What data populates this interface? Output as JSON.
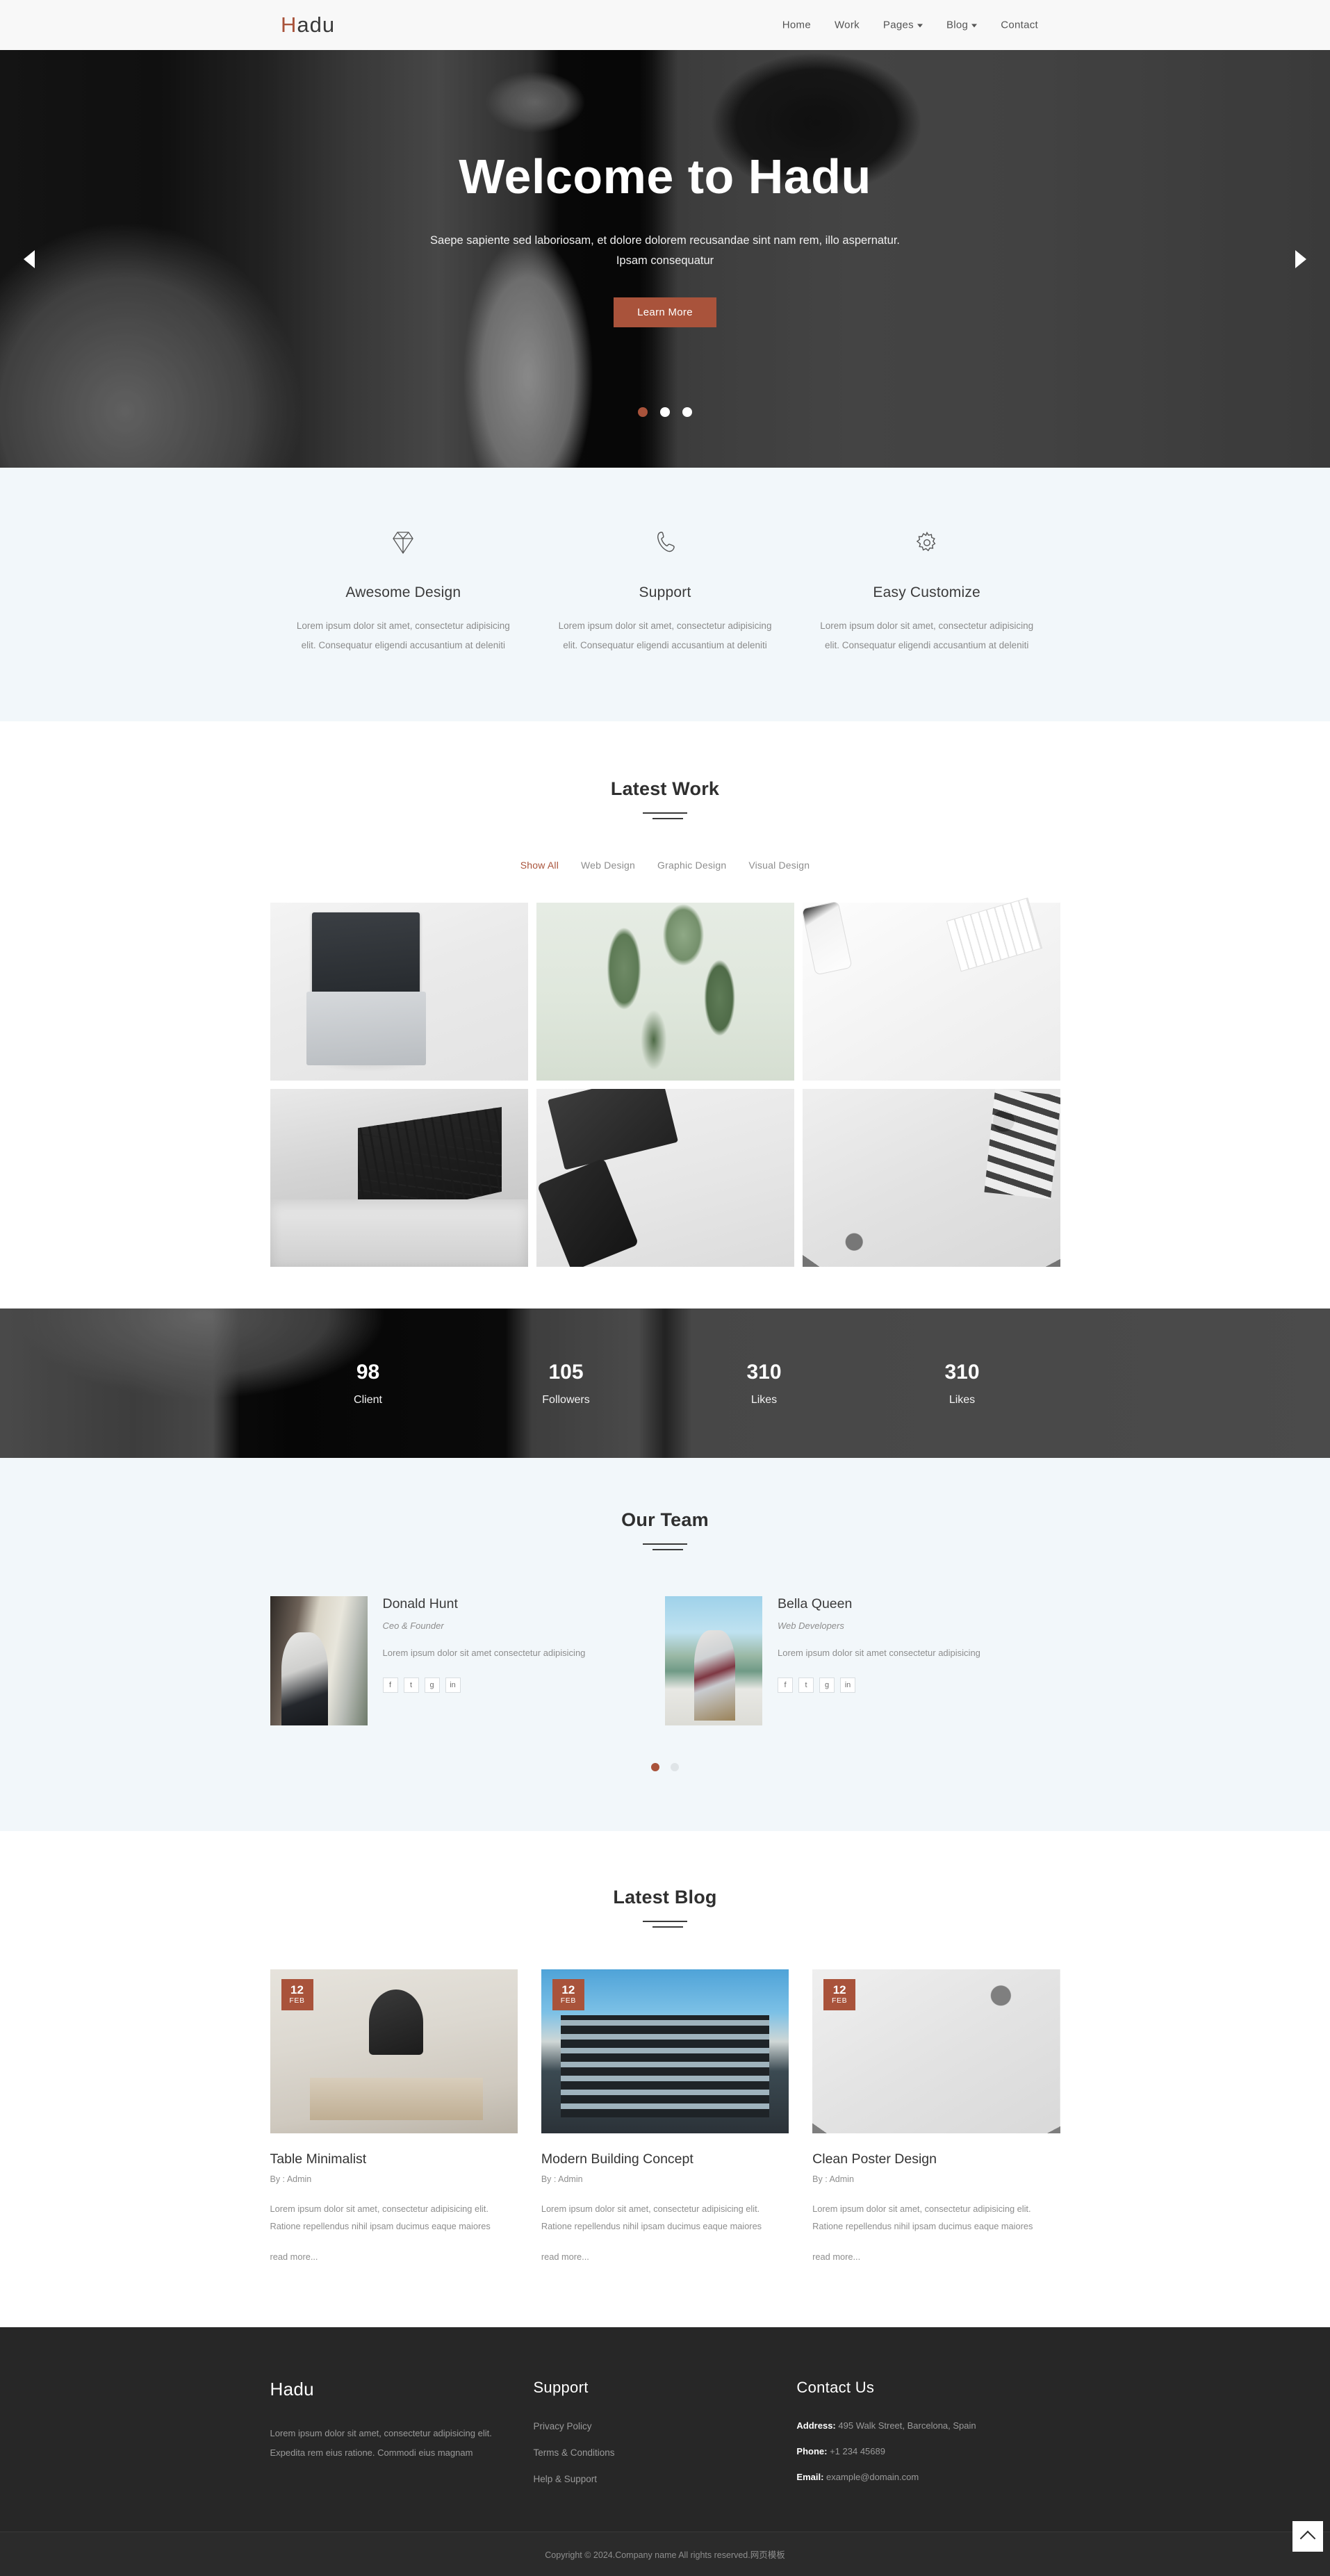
{
  "brand": {
    "first": "H",
    "rest": "adu",
    "full": "Hadu"
  },
  "nav": [
    {
      "label": "Home",
      "dropdown": false
    },
    {
      "label": "Work",
      "dropdown": false
    },
    {
      "label": "Pages",
      "dropdown": true
    },
    {
      "label": "Blog",
      "dropdown": true
    },
    {
      "label": "Contact",
      "dropdown": false
    }
  ],
  "hero": {
    "title": "Welcome to Hadu",
    "subtitle": "Saepe sapiente sed laboriosam, et dolore dolorem recusandae sint nam rem, illo aspernatur. Ipsam consequatur",
    "button": "Learn More",
    "prev_icon": "chevron-left-icon",
    "next_icon": "chevron-right-icon",
    "slide_count": 3,
    "active_slide": 1
  },
  "services": [
    {
      "icon": "diamond-icon",
      "title": "Awesome Design",
      "text": "Lorem ipsum dolor sit amet, consectetur adipisicing elit. Consequatur eligendi accusantium at deleniti"
    },
    {
      "icon": "phone-icon",
      "title": "Support",
      "text": "Lorem ipsum dolor sit amet, consectetur adipisicing elit. Consequatur eligendi accusantium at deleniti"
    },
    {
      "icon": "gear-icon",
      "title": "Easy Customize",
      "text": "Lorem ipsum dolor sit amet, consectetur adipisicing elit. Consequatur eligendi accusantium at deleniti"
    }
  ],
  "work": {
    "title": "Latest Work",
    "filters": [
      {
        "label": "Show All",
        "active": true
      },
      {
        "label": "Web Design",
        "active": false
      },
      {
        "label": "Graphic Design",
        "active": false
      },
      {
        "label": "Visual Design",
        "active": false
      }
    ],
    "items": [
      {
        "alt": "laptop-notebook-ruler-pencil-flatlay"
      },
      {
        "alt": "green-plant-leaves"
      },
      {
        "alt": "phone-keyboard-notebook-earphones-desk"
      },
      {
        "alt": "black-white-architecture-staircase"
      },
      {
        "alt": "notebook-phone-laptop-flatlay"
      },
      {
        "alt": "typography-posters-collage"
      }
    ]
  },
  "counters": [
    {
      "num": "98",
      "label": "Client"
    },
    {
      "num": "105",
      "label": "Followers"
    },
    {
      "num": "310",
      "label": "Likes"
    },
    {
      "num": "310",
      "label": "Likes"
    }
  ],
  "team": {
    "title": "Our Team",
    "members": [
      {
        "name": "Donald Hunt",
        "role": "Ceo & Founder",
        "text": "Lorem ipsum dolor sit amet consectetur adipisicing",
        "photo_alt": "man-in-shirt-and-tie-sitting-by-window",
        "socials": [
          "facebook-icon",
          "twitter-icon",
          "google-plus-icon",
          "linkedin-icon"
        ]
      },
      {
        "name": "Bella Queen",
        "role": "Web Developers",
        "text": "Lorem ipsum dolor sit amet consectetur adipisicing",
        "photo_alt": "man-with-sunglasses-by-mountain-lake",
        "socials": [
          "facebook-icon",
          "twitter-icon",
          "google-plus-icon",
          "linkedin-icon"
        ]
      }
    ],
    "dot_count": 2,
    "active_dot": 1
  },
  "blog": {
    "title": "Latest Blog",
    "posts": [
      {
        "day": "12",
        "month": "FEB",
        "title": "Table Minimalist",
        "by": "By : Admin",
        "text": "Lorem ipsum dolor sit amet, consectetur adipisicing elit. Ratione repellendus nihil ipsam ducimus eaque maiores",
        "more": "read more...",
        "thumb_alt": "minimalist-desk-with-lamp"
      },
      {
        "day": "12",
        "month": "FEB",
        "title": "Modern Building Concept",
        "by": "By : Admin",
        "text": "Lorem ipsum dolor sit amet, consectetur adipisicing elit. Ratione repellendus nihil ipsam ducimus eaque maiores",
        "more": "read more...",
        "thumb_alt": "modern-glass-building"
      },
      {
        "day": "12",
        "month": "FEB",
        "title": "Clean Poster Design",
        "by": "By : Admin",
        "text": "Lorem ipsum dolor sit amet, consectetur adipisicing elit. Ratione repellendus nihil ipsam ducimus eaque maiores",
        "more": "read more...",
        "thumb_alt": "typography-poster-collage"
      }
    ]
  },
  "footer": {
    "brand": "Hadu",
    "about": "Lorem ipsum dolor sit amet, consectetur adipisicing elit. Expedita rem eius ratione. Commodi eius magnam",
    "support_title": "Support",
    "support_links": [
      "Privacy Policy",
      "Terms & Conditions",
      "Help & Support"
    ],
    "contact_title": "Contact Us",
    "contact": [
      {
        "label": "Address:",
        "value": "495 Walk Street, Barcelona, Spain"
      },
      {
        "label": "Phone:",
        "value": "+1 234 45689"
      },
      {
        "label": "Email:",
        "value": "example@domain.com"
      }
    ],
    "copyright": "Copyright © 2024.Company name All rights reserved.网页模板",
    "to_top_icon": "chevron-up-icon"
  },
  "colors": {
    "accent": "#a9533b",
    "dark": "#272727",
    "light_blue": "#f2f7fa"
  }
}
